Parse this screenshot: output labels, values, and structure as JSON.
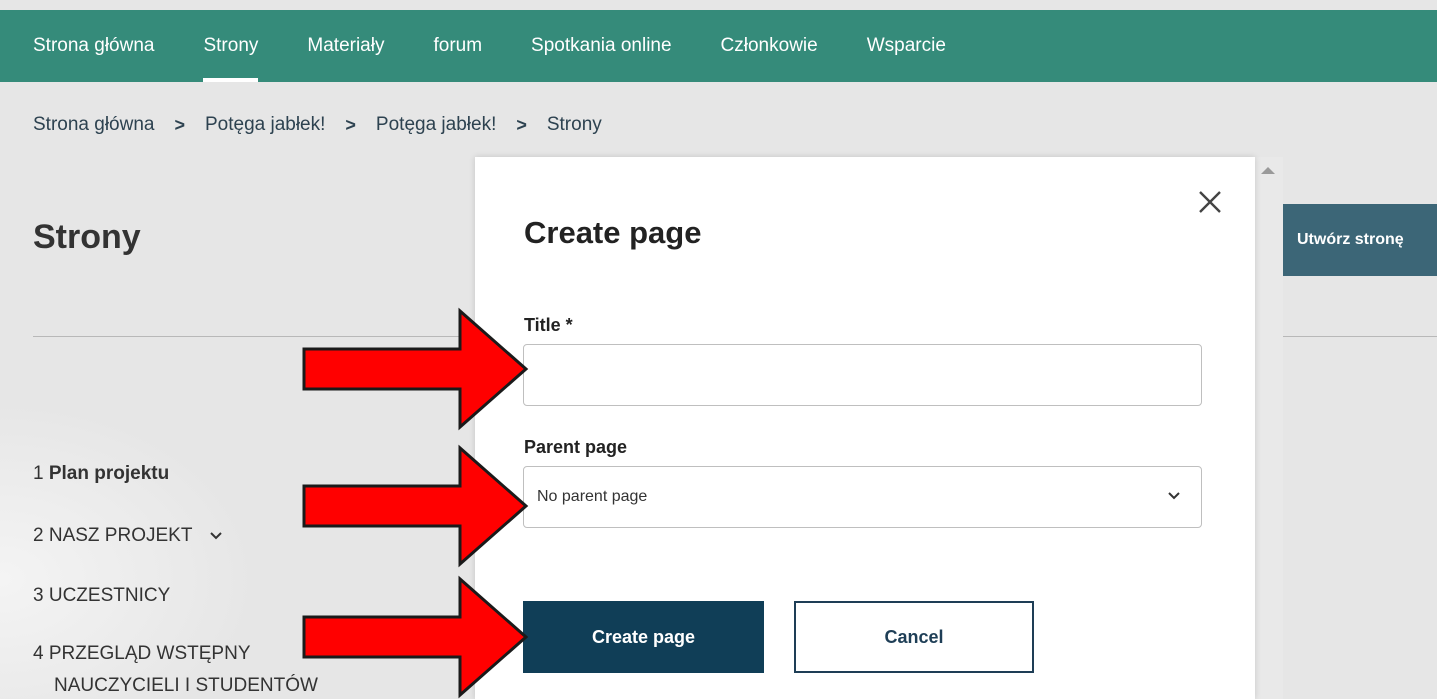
{
  "nav": {
    "items": [
      {
        "label": "Strona główna",
        "active": false
      },
      {
        "label": "Strony",
        "active": true
      },
      {
        "label": "Materiały",
        "active": false
      },
      {
        "label": "forum",
        "active": false
      },
      {
        "label": "Spotkania online",
        "active": false
      },
      {
        "label": "Członkowie",
        "active": false
      },
      {
        "label": "Wsparcie",
        "active": false
      }
    ]
  },
  "breadcrumb": {
    "items": [
      "Strona główna",
      "Potęga jabłek!",
      "Potęga jabłek!",
      "Strony"
    ],
    "separator": ">"
  },
  "page": {
    "title": "Strony",
    "create_button_label": "Utwórz stronę"
  },
  "page_list": [
    {
      "number": "1",
      "label": "Plan projektu"
    },
    {
      "number": "2",
      "label": "NASZ PROJEKT"
    },
    {
      "number": "3",
      "label": "UCZESTNICY"
    },
    {
      "number": "4",
      "label": "PRZEGLĄD WSTĘPNY",
      "label_line2": "NAUCZYCIELI I STUDENTÓW"
    }
  ],
  "modal": {
    "title": "Create page",
    "title_field_label": "Title *",
    "title_field_value": "",
    "parent_field_label": "Parent page",
    "parent_field_value": "No parent page",
    "submit_label": "Create page",
    "cancel_label": "Cancel"
  },
  "colors": {
    "nav_bg": "#358b7a",
    "primary_button": "#103e57",
    "annotation_arrow": "#ff0000"
  }
}
